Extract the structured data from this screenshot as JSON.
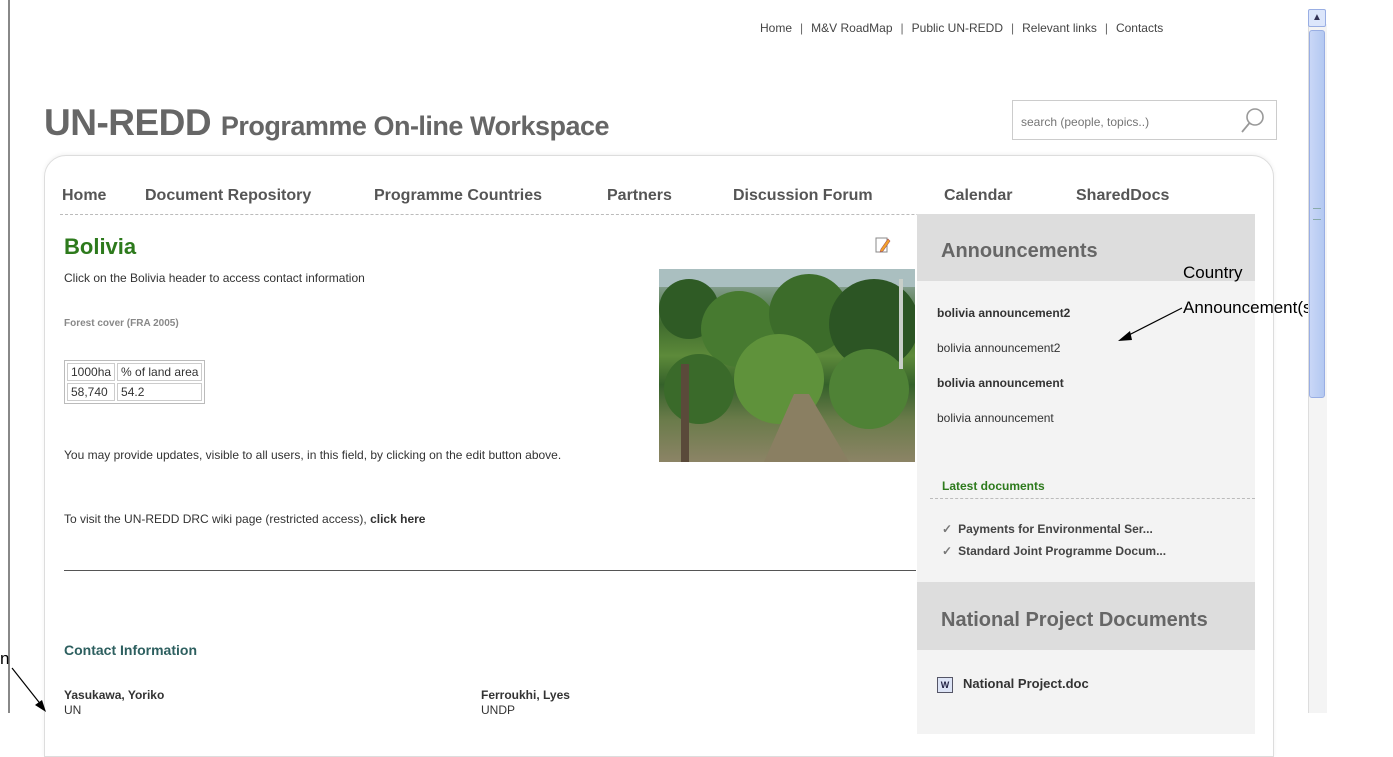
{
  "toplinks": [
    "Home",
    "M&V RoadMap",
    "Public UN-REDD",
    "Relevant links",
    "Contacts"
  ],
  "logo": {
    "big": "UN-REDD",
    "rest": "Programme On-line Workspace"
  },
  "search": {
    "placeholder": "search (people, topics..)"
  },
  "nav": [
    "Home",
    "Document Repository",
    "Programme Countries",
    "Partners",
    "Discussion Forum",
    "Calendar",
    "SharedDocs"
  ],
  "content": {
    "title": "Bolivia",
    "intro": "Click on the Bolivia header to access contact information",
    "forest_label": "Forest cover (FRA 2005)",
    "table": {
      "headers": [
        "1000ha",
        "% of land area"
      ],
      "row": [
        "58,740",
        "54.2"
      ]
    },
    "update_note": "You may provide updates, visible to all users, in this field, by clicking on the edit button above.",
    "wiki_text": "To visit the UN-REDD DRC wiki page (restricted access),",
    "wiki_link": "click here",
    "contact_heading": "Contact Information",
    "contacts": [
      {
        "name": "Yasukawa, Yoriko",
        "org": "UN"
      },
      {
        "name": "Ferroukhi, Lyes",
        "org": "UNDP"
      }
    ]
  },
  "sidebar": {
    "announcements_title": "Announcements",
    "announcements": [
      "bolivia announcement2",
      "bolivia announcement2",
      "bolivia announcement",
      "bolivia announcement"
    ],
    "latest_title": "Latest documents",
    "latest_docs": [
      "Payments for Environmental Ser...",
      "Standard Joint Programme Docum..."
    ],
    "national_title": "National Project Documents",
    "national_docs": [
      "National Project.doc"
    ]
  },
  "annotations": {
    "country_line1": "Country",
    "country_line2": "Announcement(s)",
    "left_fragment": "n"
  },
  "colors": {
    "accent_green": "#2d7a1c",
    "sidebar_bg": "#f3f3f3",
    "sidebar_header_bg": "#dddddd"
  }
}
